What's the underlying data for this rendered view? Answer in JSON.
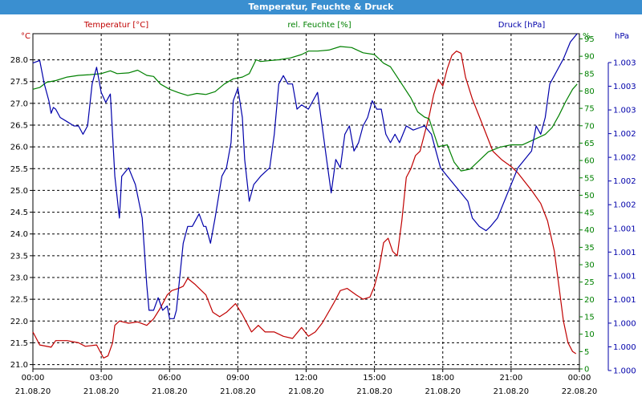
{
  "window": {
    "title": "Temperatur, Feuchte & Druck"
  },
  "chart_data": {
    "type": "line",
    "title": "Temperatur, Feuchte & Druck",
    "grid": true,
    "colors": {
      "temperature": "#c00000",
      "humidity": "#008000",
      "pressure": "#0000aa",
      "titlebar": "#3a8fd0",
      "grid": "#000000"
    },
    "x_ticks": [
      {
        "time": "00:00",
        "date": "21.08.20"
      },
      {
        "time": "03:00",
        "date": "21.08.20"
      },
      {
        "time": "06:00",
        "date": "21.08.20"
      },
      {
        "time": "09:00",
        "date": "21.08.20"
      },
      {
        "time": "12:00",
        "date": "21.08.20"
      },
      {
        "time": "15:00",
        "date": "21.08.20"
      },
      {
        "time": "18:00",
        "date": "21.08.20"
      },
      {
        "time": "21:00",
        "date": "21.08.20"
      },
      {
        "time": "00:00",
        "date": "22.08.20"
      }
    ],
    "xlim_hours": [
      0,
      24
    ],
    "axes": {
      "left": {
        "unit": "°C",
        "ylim": [
          20.9,
          28.6
        ],
        "ticks": [
          "21.0",
          "21.5",
          "22.0",
          "22.5",
          "23.0",
          "23.5",
          "24.0",
          "24.5",
          "25.0",
          "25.5",
          "26.0",
          "26.5",
          "27.0",
          "27.5",
          "28.0"
        ]
      },
      "right1": {
        "unit": "%",
        "ylim": [
          0,
          96.5
        ],
        "ticks": [
          "0",
          "5",
          "10",
          "15",
          "20",
          "25",
          "30",
          "35",
          "40",
          "45",
          "50",
          "55",
          "60",
          "65",
          "70",
          "75",
          "80",
          "85",
          "90",
          "95"
        ]
      },
      "right2": {
        "unit": "hPa",
        "ylim": [
          0.9995,
          1.0035
        ],
        "ticks": [
          "1.000",
          "1.000",
          "1.000",
          "1.001",
          "1.001",
          "1.001",
          "1.001",
          "1.002",
          "1.002",
          "1.002",
          "1.002",
          "1.003",
          "1.003",
          "1.003"
        ]
      }
    },
    "series": [
      {
        "name": "Temperatur [°C]",
        "axis": "left",
        "color": "#c00000",
        "points": [
          [
            0,
            21.75
          ],
          [
            0.3,
            21.45
          ],
          [
            0.8,
            21.4
          ],
          [
            1.0,
            21.55
          ],
          [
            1.5,
            21.55
          ],
          [
            2.0,
            21.5
          ],
          [
            2.3,
            21.42
          ],
          [
            2.8,
            21.45
          ],
          [
            3.1,
            21.15
          ],
          [
            3.3,
            21.2
          ],
          [
            3.5,
            21.5
          ],
          [
            3.6,
            21.9
          ],
          [
            3.8,
            22.0
          ],
          [
            4.2,
            21.95
          ],
          [
            4.6,
            21.98
          ],
          [
            5.0,
            21.9
          ],
          [
            5.3,
            22.05
          ],
          [
            5.6,
            22.3
          ],
          [
            5.9,
            22.6
          ],
          [
            6.1,
            22.7
          ],
          [
            6.4,
            22.75
          ],
          [
            6.6,
            22.8
          ],
          [
            6.8,
            22.98
          ],
          [
            7.1,
            22.85
          ],
          [
            7.6,
            22.6
          ],
          [
            7.9,
            22.2
          ],
          [
            8.2,
            22.1
          ],
          [
            8.5,
            22.2
          ],
          [
            8.9,
            22.4
          ],
          [
            9.2,
            22.15
          ],
          [
            9.6,
            21.75
          ],
          [
            9.9,
            21.9
          ],
          [
            10.2,
            21.75
          ],
          [
            10.6,
            21.75
          ],
          [
            11.0,
            21.65
          ],
          [
            11.4,
            21.6
          ],
          [
            11.8,
            21.85
          ],
          [
            12.1,
            21.65
          ],
          [
            12.4,
            21.75
          ],
          [
            12.7,
            21.95
          ],
          [
            13.2,
            22.4
          ],
          [
            13.5,
            22.7
          ],
          [
            13.8,
            22.75
          ],
          [
            14.2,
            22.6
          ],
          [
            14.5,
            22.5
          ],
          [
            14.8,
            22.55
          ],
          [
            15.0,
            22.8
          ],
          [
            15.2,
            23.2
          ],
          [
            15.4,
            23.8
          ],
          [
            15.6,
            23.9
          ],
          [
            15.8,
            23.6
          ],
          [
            16.0,
            23.5
          ],
          [
            16.2,
            24.3
          ],
          [
            16.4,
            25.3
          ],
          [
            16.6,
            25.5
          ],
          [
            16.8,
            25.8
          ],
          [
            17.0,
            25.9
          ],
          [
            17.2,
            26.3
          ],
          [
            17.4,
            26.7
          ],
          [
            17.6,
            27.2
          ],
          [
            17.8,
            27.55
          ],
          [
            18.0,
            27.4
          ],
          [
            18.2,
            27.8
          ],
          [
            18.4,
            28.1
          ],
          [
            18.6,
            28.2
          ],
          [
            18.8,
            28.15
          ],
          [
            19.0,
            27.6
          ],
          [
            19.3,
            27.1
          ],
          [
            19.6,
            26.7
          ],
          [
            19.9,
            26.3
          ],
          [
            20.2,
            25.9
          ],
          [
            20.6,
            25.7
          ],
          [
            21.0,
            25.55
          ],
          [
            21.3,
            25.4
          ],
          [
            21.6,
            25.2
          ],
          [
            21.9,
            25.0
          ],
          [
            22.3,
            24.7
          ],
          [
            22.6,
            24.3
          ],
          [
            22.9,
            23.6
          ],
          [
            23.1,
            22.8
          ],
          [
            23.3,
            22.0
          ],
          [
            23.5,
            21.5
          ],
          [
            23.7,
            21.3
          ],
          [
            23.85,
            21.25
          ]
        ]
      },
      {
        "name": "rel. Feuchte [%]",
        "axis": "right1",
        "color": "#008000",
        "points": [
          [
            0,
            80.5
          ],
          [
            0.3,
            81.0
          ],
          [
            0.6,
            82.5
          ],
          [
            1.0,
            83.0
          ],
          [
            1.5,
            84.0
          ],
          [
            2.0,
            84.5
          ],
          [
            2.5,
            84.7
          ],
          [
            3.0,
            85.0
          ],
          [
            3.4,
            85.8
          ],
          [
            3.7,
            85.0
          ],
          [
            4.2,
            85.2
          ],
          [
            4.6,
            86.0
          ],
          [
            5.0,
            84.5
          ],
          [
            5.3,
            84.2
          ],
          [
            5.6,
            82.0
          ],
          [
            6.0,
            80.5
          ],
          [
            6.4,
            79.5
          ],
          [
            6.8,
            78.7
          ],
          [
            7.2,
            79.3
          ],
          [
            7.6,
            79.0
          ],
          [
            8.0,
            79.8
          ],
          [
            8.4,
            82.0
          ],
          [
            8.8,
            83.5
          ],
          [
            9.2,
            84.0
          ],
          [
            9.5,
            85.0
          ],
          [
            9.8,
            89.0
          ],
          [
            10.0,
            88.5
          ],
          [
            10.3,
            88.7
          ],
          [
            10.8,
            89.0
          ],
          [
            11.3,
            89.5
          ],
          [
            11.8,
            90.5
          ],
          [
            12.1,
            91.5
          ],
          [
            12.5,
            91.5
          ],
          [
            13.0,
            91.8
          ],
          [
            13.5,
            92.8
          ],
          [
            14.0,
            92.5
          ],
          [
            14.5,
            91.0
          ],
          [
            15.0,
            90.5
          ],
          [
            15.4,
            88.0
          ],
          [
            15.7,
            87.0
          ],
          [
            16.0,
            84.0
          ],
          [
            16.3,
            81.0
          ],
          [
            16.6,
            78.0
          ],
          [
            16.9,
            74.0
          ],
          [
            17.2,
            72.5
          ],
          [
            17.4,
            72.0
          ],
          [
            17.6,
            68.0
          ],
          [
            17.8,
            64.0
          ],
          [
            18.2,
            64.5
          ],
          [
            18.5,
            59.5
          ],
          [
            18.8,
            57.0
          ],
          [
            19.2,
            57.5
          ],
          [
            19.6,
            60.0
          ],
          [
            20.0,
            62.5
          ],
          [
            20.5,
            63.8
          ],
          [
            21.0,
            64.5
          ],
          [
            21.5,
            64.5
          ],
          [
            22.0,
            66.0
          ],
          [
            22.5,
            67.5
          ],
          [
            22.8,
            69.5
          ],
          [
            23.1,
            73.0
          ],
          [
            23.4,
            77.0
          ],
          [
            23.7,
            80.5
          ],
          [
            23.9,
            82.0
          ]
        ]
      },
      {
        "name": "Druck [hPa]",
        "axis": "right2",
        "color": "#0000aa",
        "points": [
          [
            0,
            1.00315
          ],
          [
            0.3,
            1.00318
          ],
          [
            0.5,
            1.0029
          ],
          [
            0.7,
            1.0027
          ],
          [
            0.8,
            1.00255
          ],
          [
            0.9,
            1.00262
          ],
          [
            1.0,
            1.0026
          ],
          [
            1.2,
            1.0025
          ],
          [
            1.5,
            1.00245
          ],
          [
            1.8,
            1.0024
          ],
          [
            2.0,
            1.0024
          ],
          [
            2.2,
            1.0023
          ],
          [
            2.4,
            1.0024
          ],
          [
            2.6,
            1.0029
          ],
          [
            2.8,
            1.0031
          ],
          [
            3.0,
            1.0028
          ],
          [
            3.2,
            1.00268
          ],
          [
            3.4,
            1.00278
          ],
          [
            3.6,
            1.0018
          ],
          [
            3.8,
            1.0013
          ],
          [
            3.9,
            1.0018
          ],
          [
            4.2,
            1.0019
          ],
          [
            4.5,
            1.0017
          ],
          [
            4.8,
            1.0013
          ],
          [
            5.0,
            1.0005
          ],
          [
            5.1,
            1.0002
          ],
          [
            5.3,
            1.0002
          ],
          [
            5.5,
            1.00035
          ],
          [
            5.7,
            1.0002
          ],
          [
            5.9,
            1.00025
          ],
          [
            6.0,
            1.0001
          ],
          [
            6.2,
            1.0001
          ],
          [
            6.3,
            1.0002
          ],
          [
            6.6,
            1.001
          ],
          [
            6.8,
            1.0012
          ],
          [
            7.0,
            1.0012
          ],
          [
            7.3,
            1.00135
          ],
          [
            7.5,
            1.0012
          ],
          [
            7.6,
            1.0012
          ],
          [
            7.8,
            1.001
          ],
          [
            8.0,
            1.0013
          ],
          [
            8.3,
            1.0018
          ],
          [
            8.5,
            1.0019
          ],
          [
            8.7,
            1.0022
          ],
          [
            8.8,
            1.0027
          ],
          [
            9.0,
            1.00285
          ],
          [
            9.2,
            1.0025
          ],
          [
            9.3,
            1.002
          ],
          [
            9.5,
            1.0015
          ],
          [
            9.7,
            1.0017
          ],
          [
            10.0,
            1.0018
          ],
          [
            10.2,
            1.00185
          ],
          [
            10.4,
            1.0019
          ],
          [
            10.6,
            1.0023
          ],
          [
            10.8,
            1.0029
          ],
          [
            11.0,
            1.003
          ],
          [
            11.2,
            1.0029
          ],
          [
            11.4,
            1.0029
          ],
          [
            11.6,
            1.0026
          ],
          [
            11.8,
            1.00265
          ],
          [
            12.1,
            1.0026
          ],
          [
            12.3,
            1.0027
          ],
          [
            12.5,
            1.0028
          ],
          [
            12.7,
            1.0024
          ],
          [
            12.9,
            1.002
          ],
          [
            13.1,
            1.0016
          ],
          [
            13.3,
            1.002
          ],
          [
            13.5,
            1.0019
          ],
          [
            13.7,
            1.0023
          ],
          [
            13.9,
            1.0024
          ],
          [
            14.1,
            1.0021
          ],
          [
            14.3,
            1.0022
          ],
          [
            14.5,
            1.0024
          ],
          [
            14.7,
            1.0025
          ],
          [
            14.9,
            1.0027
          ],
          [
            15.1,
            1.0026
          ],
          [
            15.3,
            1.0026
          ],
          [
            15.5,
            1.0023
          ],
          [
            15.7,
            1.0022
          ],
          [
            15.9,
            1.0023
          ],
          [
            16.1,
            1.0022
          ],
          [
            16.4,
            1.0024
          ],
          [
            16.7,
            1.00235
          ],
          [
            17.0,
            1.00238
          ],
          [
            17.2,
            1.0024
          ],
          [
            17.5,
            1.0023
          ],
          [
            17.7,
            1.0021
          ],
          [
            17.9,
            1.0019
          ],
          [
            18.2,
            1.0018
          ],
          [
            18.5,
            1.0017
          ],
          [
            18.8,
            1.0016
          ],
          [
            19.1,
            1.0015
          ],
          [
            19.3,
            1.0013
          ],
          [
            19.6,
            1.0012
          ],
          [
            19.9,
            1.00115
          ],
          [
            20.1,
            1.0012
          ],
          [
            20.4,
            1.0013
          ],
          [
            20.7,
            1.0015
          ],
          [
            21.0,
            1.0017
          ],
          [
            21.3,
            1.0019
          ],
          [
            21.6,
            1.002
          ],
          [
            21.9,
            1.0021
          ],
          [
            22.1,
            1.0024
          ],
          [
            22.3,
            1.0023
          ],
          [
            22.5,
            1.0025
          ],
          [
            22.7,
            1.0029
          ],
          [
            23.0,
            1.00305
          ],
          [
            23.3,
            1.0032
          ],
          [
            23.6,
            1.0034
          ],
          [
            23.9,
            1.0035
          ]
        ]
      }
    ]
  }
}
